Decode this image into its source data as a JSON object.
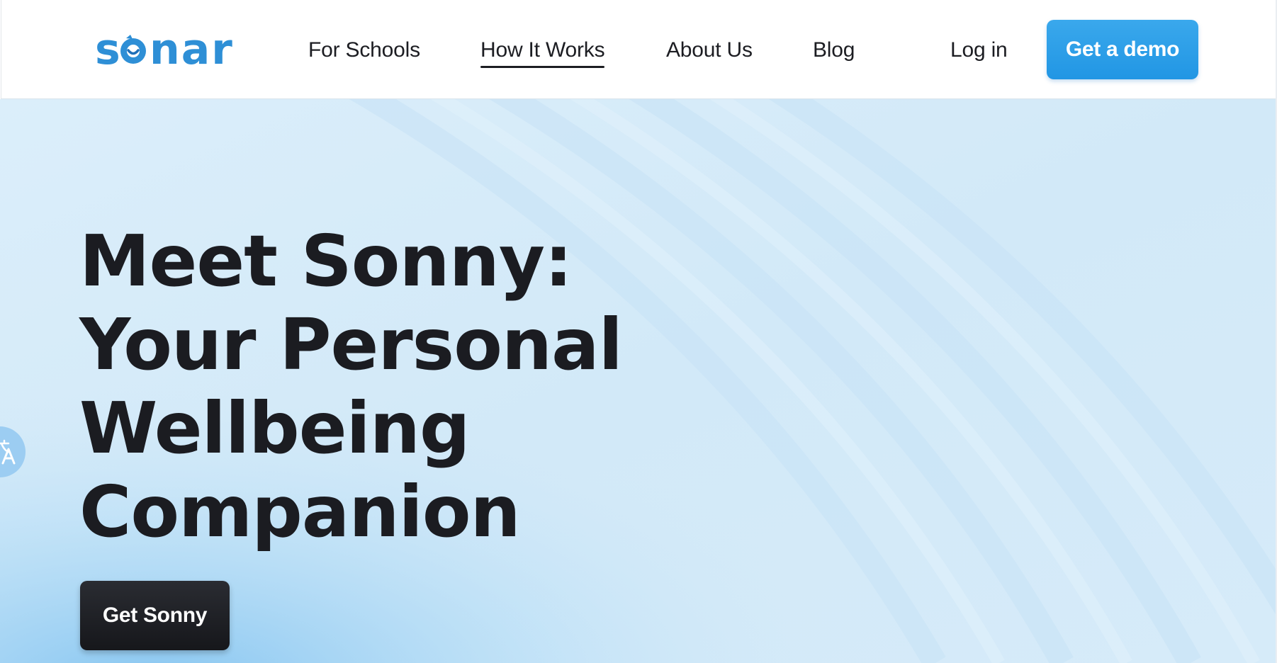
{
  "brand": {
    "name": "sonar",
    "logo_color": "#2e8fd6",
    "icon": "sonar-logo-icon"
  },
  "nav": {
    "items": [
      {
        "label": "For Schools"
      },
      {
        "label": "How It Works",
        "active": true
      },
      {
        "label": "About Us"
      },
      {
        "label": "Blog"
      }
    ],
    "login_label": "Log in",
    "demo_label": "Get a demo",
    "demo_color": "#2a9fe8"
  },
  "hero": {
    "title_lines": [
      "Meet Sonny:",
      "Your Personal",
      "Wellbeing",
      "Companion"
    ],
    "cta_label": "Get Sonny",
    "background_color": "#d3e9f8",
    "text_color": "#1b1c21"
  },
  "translate_widget": {
    "icon": "translate-icon"
  }
}
